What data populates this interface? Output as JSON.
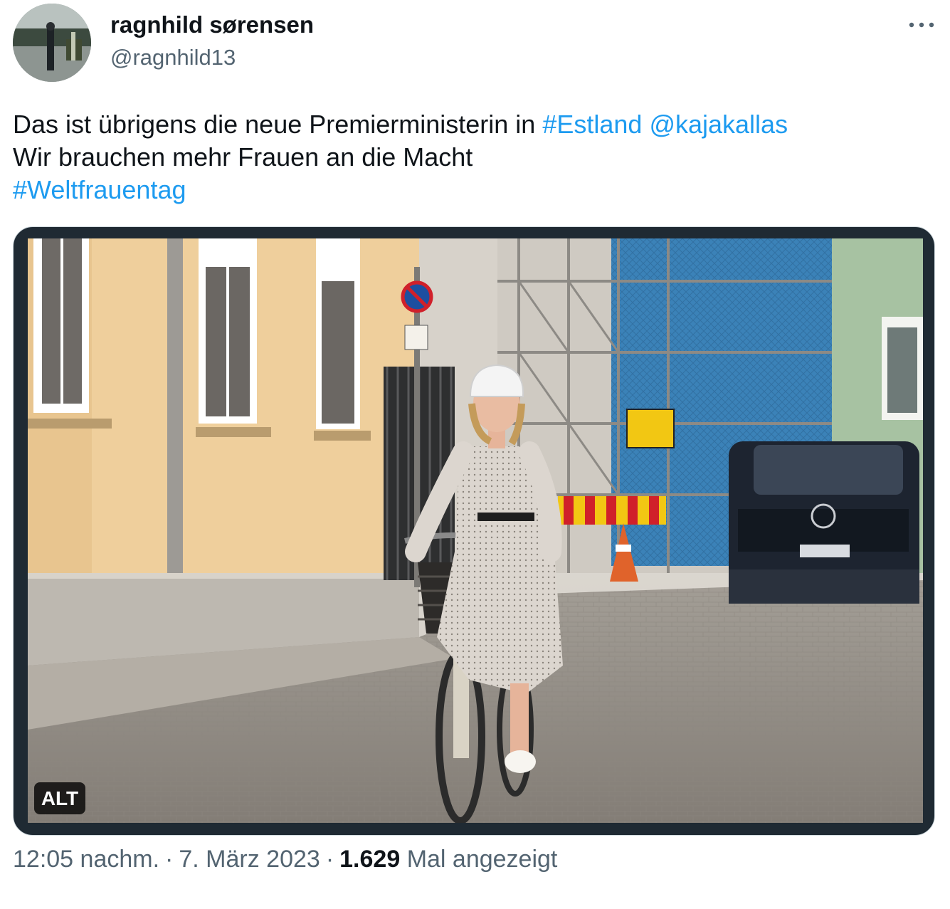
{
  "author": {
    "display_name": "ragnhild sørensen",
    "handle": "@ragnhild13",
    "avatar_icon": "profile-photo-avatar"
  },
  "more_icon": "more-horizontal-icon",
  "tweet": {
    "line1_text": "Das ist übrigens die neue Premierministerin in ",
    "hashtag_estland": "#Estland",
    "mention_kajakallas": "@kajakallas",
    "line2_text": "Wir brauchen mehr Frauen an die Macht",
    "hashtag_weltfrauentag": "#Weltfrauentag",
    "link_color": "#1d9bf0"
  },
  "media": {
    "alt_label": "ALT"
  },
  "meta": {
    "time": "12:05 nachm.",
    "date": "7. März 2023",
    "separator": "·",
    "views_count": "1.629",
    "views_label": "Mal angezeigt"
  }
}
